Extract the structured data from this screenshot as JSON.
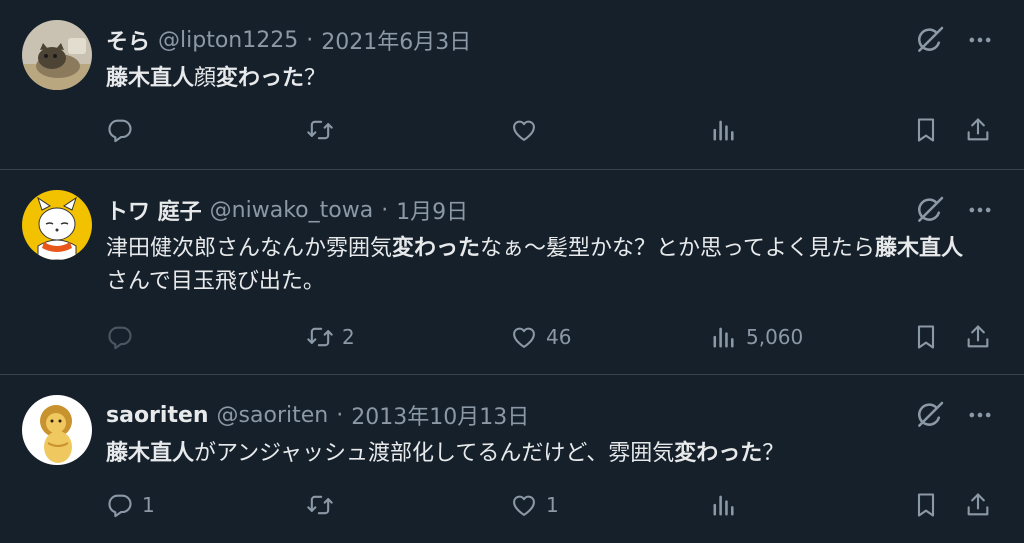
{
  "tweets": [
    {
      "name": "そら",
      "handle": "@lipton1225",
      "separator": "·",
      "time": "2021年6月3日",
      "text": [
        {
          "t": "藤木直人",
          "b": true
        },
        {
          "t": "顔",
          "b": false
        },
        {
          "t": "変わった",
          "b": true
        },
        {
          "t": "？",
          "b": false
        }
      ],
      "replies": "",
      "retweets": "",
      "likes": "",
      "views": ""
    },
    {
      "name": "トワ 庭子",
      "handle": "@niwako_towa",
      "separator": "·",
      "time": "1月9日",
      "text": [
        {
          "t": "津田健次郎さんなんか雰囲気",
          "b": false
        },
        {
          "t": "変わった",
          "b": true
        },
        {
          "t": "なぁ〜髪型かな？とか思ってよく見たら",
          "b": false
        },
        {
          "t": "藤木直人",
          "b": true
        },
        {
          "t": "さんで目玉飛び出た。",
          "b": false
        }
      ],
      "replies": "",
      "retweets": "2",
      "likes": "46",
      "views": "5,060"
    },
    {
      "name": "saoriten",
      "handle": "@saoriten",
      "separator": "·",
      "time": "2013年10月13日",
      "text": [
        {
          "t": "藤木直人",
          "b": true
        },
        {
          "t": "がアンジャッシュ渡部化してるんだけど、雰囲気",
          "b": false
        },
        {
          "t": "変わった",
          "b": true
        },
        {
          "t": "？",
          "b": false
        }
      ],
      "replies": "1",
      "retweets": "",
      "likes": "1",
      "views": ""
    }
  ],
  "colors": {
    "background": "#15202b",
    "text": "#e7e9ea",
    "secondary": "#8b98a5",
    "divider": "#38444d"
  },
  "icons": [
    "grok-icon",
    "more-icon",
    "reply-icon",
    "retweet-icon",
    "like-icon",
    "views-icon",
    "bookmark-icon",
    "share-icon"
  ]
}
